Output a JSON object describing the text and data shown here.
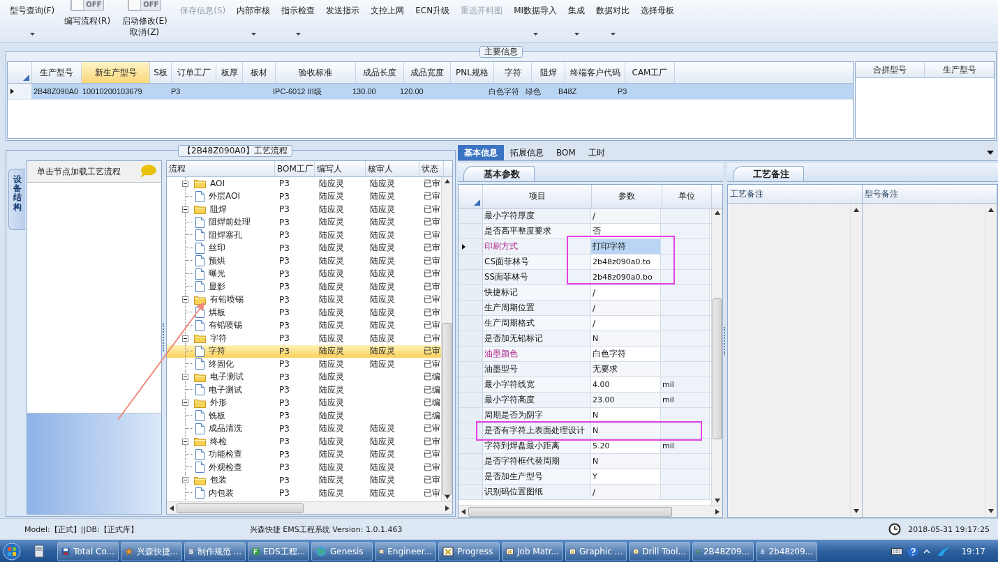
{
  "toolbar": [
    {
      "kind": "button",
      "label": "型号查询(F)",
      "menu": true,
      "disabled": false
    },
    {
      "kind": "toggle",
      "state_label": "OFF",
      "on": false,
      "label": "编写流程(R)"
    },
    {
      "kind": "toggle",
      "state_label": "OFF",
      "on": false,
      "label": "启动修改(E)",
      "label2": "取消(Z)"
    },
    {
      "kind": "button",
      "label": "保存信息(S)",
      "menu": false,
      "disabled": true
    },
    {
      "kind": "button",
      "label": "内部审核",
      "menu": true,
      "disabled": false
    },
    {
      "kind": "button",
      "label": "指示检查",
      "menu": true,
      "disabled": false
    },
    {
      "kind": "button",
      "label": "发送指示",
      "menu": false,
      "disabled": false
    },
    {
      "kind": "button",
      "label": "文控上网",
      "menu": false,
      "disabled": false
    },
    {
      "kind": "button",
      "label": "ECN升级",
      "menu": false,
      "disabled": false
    },
    {
      "kind": "button",
      "label": "重选开料图",
      "menu": false,
      "disabled": true
    },
    {
      "kind": "button",
      "label": "MI数据导入",
      "menu": true,
      "disabled": false
    },
    {
      "kind": "button",
      "label": "集成",
      "menu": true,
      "disabled": false
    },
    {
      "kind": "button",
      "label": "数据对比",
      "menu": true,
      "disabled": false
    },
    {
      "kind": "button",
      "label": "选择母板",
      "menu": false,
      "disabled": false
    }
  ],
  "main_info": {
    "title": "主要信息",
    "columns": [
      {
        "label": "生产型号",
        "selected": false
      },
      {
        "label": "新生产型号",
        "selected": true
      },
      {
        "label": "S板",
        "selected": false
      },
      {
        "label": "订单工厂",
        "selected": false
      },
      {
        "label": "板厚",
        "selected": false
      },
      {
        "label": "板材",
        "selected": false
      },
      {
        "label": "验收标准",
        "selected": false
      },
      {
        "label": "成品长度",
        "selected": false
      },
      {
        "label": "成品宽度",
        "selected": false
      },
      {
        "label": "PNL规格",
        "selected": false
      },
      {
        "label": "字符",
        "selected": false
      },
      {
        "label": "阻焊",
        "selected": false
      },
      {
        "label": "终端客户代码",
        "selected": false
      },
      {
        "label": "CAM工厂",
        "selected": false
      }
    ],
    "rows": [
      {
        "selected": true,
        "cells": [
          "2B48Z090A0",
          "10010200103679",
          null,
          "P3",
          null,
          null,
          "IPC-6012 III级",
          "130.00",
          "120.00",
          null,
          "白色字符",
          "绿色",
          "B48Z",
          "P3"
        ]
      }
    ],
    "side_columns": [
      "合拼型号",
      "生产型号"
    ]
  },
  "process": {
    "title": "【2B48Z090A0】工艺流程",
    "side_tab": "设备结构",
    "hint": "单击节点加载工艺流程",
    "annotation_arrow": true,
    "columns": [
      "流程",
      "BOM工厂",
      "编写人",
      "核审人",
      "状态"
    ],
    "tree": [
      {
        "kind": "folder",
        "name": "AOI",
        "expanded": true,
        "selected": false,
        "bom": "P3",
        "writer": "陆应灵",
        "reviewer": "陆应灵",
        "status": "已审",
        "children": [
          {
            "kind": "step",
            "name": "外层AOI",
            "selected": false,
            "bom": "P3",
            "writer": "陆应灵",
            "reviewer": "陆应灵",
            "status": "已审"
          }
        ]
      },
      {
        "kind": "folder",
        "name": "阻焊",
        "expanded": true,
        "selected": false,
        "bom": "P3",
        "writer": "陆应灵",
        "reviewer": "陆应灵",
        "status": "已审",
        "children": [
          {
            "kind": "step",
            "name": "阻焊前处理",
            "selected": false,
            "bom": "P3",
            "writer": "陆应灵",
            "reviewer": "陆应灵",
            "status": "已审"
          },
          {
            "kind": "step",
            "name": "阻焊塞孔",
            "selected": false,
            "bom": "P3",
            "writer": "陆应灵",
            "reviewer": "陆应灵",
            "status": "已审"
          },
          {
            "kind": "step",
            "name": "丝印",
            "selected": false,
            "bom": "P3",
            "writer": "陆应灵",
            "reviewer": "陆应灵",
            "status": "已审"
          },
          {
            "kind": "step",
            "name": "预烘",
            "selected": false,
            "bom": "P3",
            "writer": "陆应灵",
            "reviewer": "陆应灵",
            "status": "已审"
          },
          {
            "kind": "step",
            "name": "曝光",
            "selected": false,
            "bom": "P3",
            "writer": "陆应灵",
            "reviewer": "陆应灵",
            "status": "已审"
          },
          {
            "kind": "step",
            "name": "显影",
            "selected": false,
            "bom": "P3",
            "writer": "陆应灵",
            "reviewer": "陆应灵",
            "status": "已审"
          }
        ]
      },
      {
        "kind": "folder",
        "name": "有铅喷锡",
        "expanded": true,
        "selected": false,
        "bom": "P3",
        "writer": "陆应灵",
        "reviewer": "陆应灵",
        "status": "已审",
        "children": [
          {
            "kind": "step",
            "name": "烘板",
            "selected": false,
            "bom": "P3",
            "writer": "陆应灵",
            "reviewer": "陆应灵",
            "status": "已审"
          },
          {
            "kind": "step",
            "name": "有铅喷锡",
            "selected": false,
            "bom": "P3",
            "writer": "陆应灵",
            "reviewer": "陆应灵",
            "status": "已审"
          }
        ]
      },
      {
        "kind": "folder",
        "name": "字符",
        "expanded": true,
        "selected": false,
        "bom": "P3",
        "writer": "陆应灵",
        "reviewer": "陆应灵",
        "status": "已审",
        "children": [
          {
            "kind": "step",
            "name": "字符",
            "selected": true,
            "bom": "P3",
            "writer": "陆应灵",
            "reviewer": "陆应灵",
            "status": "已审"
          },
          {
            "kind": "step",
            "name": "终固化",
            "selected": false,
            "bom": "P3",
            "writer": "陆应灵",
            "reviewer": "陆应灵",
            "status": "已审"
          }
        ]
      },
      {
        "kind": "folder",
        "name": "电子测试",
        "expanded": true,
        "selected": false,
        "bom": "P3",
        "writer": "陆应灵",
        "status": "已编",
        "children": [
          {
            "kind": "step",
            "name": "电子测试",
            "selected": false,
            "bom": "P3",
            "writer": "陆应灵",
            "status": "已编"
          }
        ]
      },
      {
        "kind": "folder",
        "name": "外形",
        "expanded": true,
        "selected": false,
        "bom": "P3",
        "writer": "陆应灵",
        "status": "已编",
        "children": [
          {
            "kind": "step",
            "name": "铣板",
            "selected": false,
            "bom": "P3",
            "writer": "陆应灵",
            "status": "已编"
          },
          {
            "kind": "step",
            "name": "成品清洗",
            "selected": false,
            "bom": "P3",
            "writer": "陆应灵",
            "reviewer": "陆应灵",
            "status": "已审"
          }
        ]
      },
      {
        "kind": "folder",
        "name": "终检",
        "expanded": true,
        "selected": false,
        "bom": "P3",
        "writer": "陆应灵",
        "reviewer": "陆应灵",
        "status": "已审",
        "children": [
          {
            "kind": "step",
            "name": "功能检查",
            "selected": false,
            "bom": "P3",
            "writer": "陆应灵",
            "reviewer": "陆应灵",
            "status": "已审"
          },
          {
            "kind": "step",
            "name": "外观检查",
            "selected": false,
            "bom": "P3",
            "writer": "陆应灵",
            "reviewer": "陆应灵",
            "status": "已审"
          }
        ]
      },
      {
        "kind": "folder",
        "name": "包装",
        "expanded": true,
        "selected": false,
        "bom": "P3",
        "writer": "陆应灵",
        "reviewer": "陆应灵",
        "status": "已审",
        "children": [
          {
            "kind": "step",
            "name": "内包装",
            "selected": false,
            "bom": "P3",
            "writer": "陆应灵",
            "reviewer": "陆应灵",
            "status": "已审"
          }
        ]
      }
    ]
  },
  "detail": {
    "tabs": [
      {
        "label": "基本信息",
        "selected": true
      },
      {
        "label": "拓展信息",
        "selected": false
      },
      {
        "label": "BOM",
        "selected": false
      },
      {
        "label": "工时",
        "selected": false
      }
    ],
    "params": {
      "title": "基本参数",
      "columns": [
        "项目",
        "参数",
        "单位"
      ],
      "rows": [
        {
          "item": "最小字符厚度",
          "value": "/",
          "emphasis": false,
          "selected": false
        },
        {
          "item": "是否高平整度要求",
          "value": "否",
          "emphasis": false,
          "selected": false
        },
        {
          "item": "印刷方式",
          "value": "打印字符",
          "emphasis": true,
          "selected": true,
          "value_boxed": true
        },
        {
          "item": "CS面菲林号",
          "value": "2b48z090a0.to",
          "emphasis": false,
          "selected": false,
          "value_boxed": true
        },
        {
          "item": "SS面菲林号",
          "value": "2b48z090a0.bo",
          "emphasis": false,
          "selected": false,
          "value_boxed": true
        },
        {
          "item": "快捷标记",
          "value": "/",
          "emphasis": false,
          "selected": false
        },
        {
          "item": "生产周期位置",
          "value": "/",
          "emphasis": false,
          "selected": false
        },
        {
          "item": "生产周期格式",
          "value": "/",
          "emphasis": false,
          "selected": false
        },
        {
          "item": "是否加无铅标记",
          "value": "N",
          "emphasis": false,
          "selected": false
        },
        {
          "item": "油墨颜色",
          "value": "白色字符",
          "emphasis": true,
          "selected": false
        },
        {
          "item": "油墨型号",
          "value": "无要求",
          "emphasis": false,
          "selected": false
        },
        {
          "item": "最小字符线宽",
          "value": "4.00",
          "unit": "mil",
          "emphasis": false,
          "selected": false
        },
        {
          "item": "最小字符高度",
          "value": "23.00",
          "unit": "mil",
          "emphasis": false,
          "selected": false
        },
        {
          "item": "周期是否为阴字",
          "value": "N",
          "emphasis": false,
          "selected": false
        },
        {
          "item": "是否有字符上表面处理设计",
          "value": "N",
          "emphasis": false,
          "selected": false,
          "row_boxed": true
        },
        {
          "item": "字符到焊盘最小距离",
          "value": "5.20",
          "unit": "mil",
          "emphasis": false,
          "selected": false
        },
        {
          "item": "是否字符框代替周期",
          "value": "N",
          "emphasis": false,
          "selected": false
        },
        {
          "item": "是否加生产型号",
          "value": "Y",
          "emphasis": false,
          "selected": false
        },
        {
          "item": "识别码位置图纸",
          "value": "/",
          "emphasis": false,
          "selected": false
        }
      ]
    },
    "notes": {
      "title": "工艺备注",
      "columns": [
        "工艺备注",
        "型号备注"
      ]
    }
  },
  "status_bar": {
    "left": "Model:【正式】||DB:【正式库】",
    "center": "兴森快捷 EMS工程系统 Version: 1.0.1.463",
    "time": "2018-05-31 19:17:25"
  },
  "taskbar": {
    "items": [
      {
        "kind": "disk",
        "label": "Total Co..."
      },
      {
        "kind": "star",
        "label": "兴森快捷..."
      },
      {
        "kind": "doc",
        "label": "制作规范 ..."
      },
      {
        "kind": "eds",
        "label": "EDS工程..."
      },
      {
        "kind": "globe",
        "label": "Genesis"
      },
      {
        "kind": "xwin",
        "label": "Engineer..."
      },
      {
        "kind": "xwin",
        "label": "Progress"
      },
      {
        "kind": "xwin",
        "label": "Job Matr..."
      },
      {
        "kind": "xwin",
        "label": "Graphic ..."
      },
      {
        "kind": "xwin",
        "label": "Drill Tool..."
      },
      {
        "kind": "excel",
        "label": "2B48Z09..."
      },
      {
        "kind": "note",
        "label": "2b48z09..."
      }
    ],
    "clock": "19:17"
  }
}
